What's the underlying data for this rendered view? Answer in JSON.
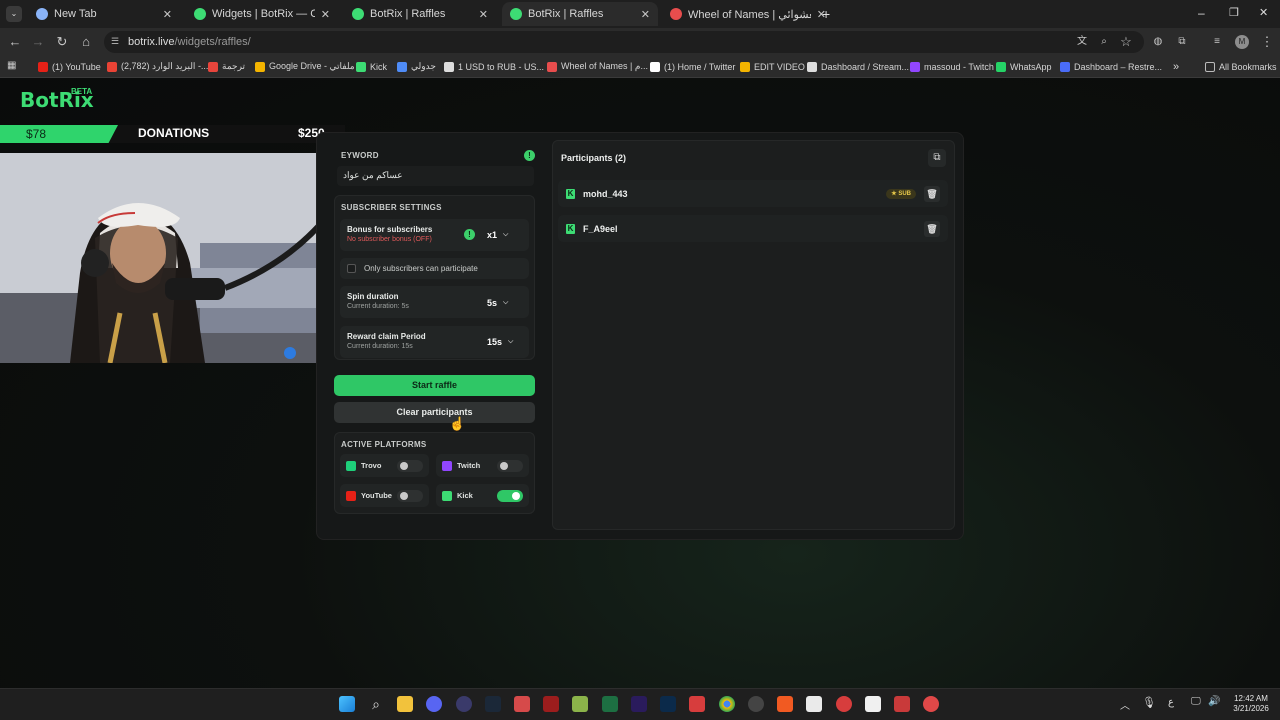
{
  "browser": {
    "tabs": [
      {
        "label": "New Tab",
        "color": "#8ab4f8"
      },
      {
        "label": "Widgets | BotRix — Cloud Strea",
        "color": "#3ddc74"
      },
      {
        "label": "BotRix | Raffles",
        "color": "#3ddc74"
      },
      {
        "label": "BotRix | Raffles",
        "color": "#3ddc74"
      },
      {
        "label": "Wheel of Names | سم العشوائي",
        "color": "#e84d4d"
      }
    ],
    "url_host": "botrix.live",
    "url_path": "/widgets/raffles/",
    "bookmarks": [
      {
        "label": "(1) YouTube",
        "color": "#e62117"
      },
      {
        "label": "(2,782) البريد الوارد -...",
        "color": "#ea4335"
      },
      {
        "label": "ترجمة",
        "color": "#e8453c"
      },
      {
        "label": "Google Drive - ملفاتي",
        "color": "#f4b400"
      },
      {
        "label": "Kick",
        "color": "#3ddc74"
      },
      {
        "label": "جدولي",
        "color": "#4f8cf7"
      },
      {
        "label": "1 USD to RUB - US...",
        "color": "#dddddd"
      },
      {
        "label": "Wheel of Names | م...",
        "color": "#e84d4d"
      },
      {
        "label": "(1) Home / Twitter",
        "color": "#ffffff"
      },
      {
        "label": "EDIT VIDEO",
        "color": "#f4b400"
      },
      {
        "label": "Dashboard / Stream...",
        "color": "#dddddd"
      },
      {
        "label": "massoud - Twitch",
        "color": "#9146ff"
      },
      {
        "label": "WhatsApp",
        "color": "#25d366"
      },
      {
        "label": "Dashboard – Restre...",
        "color": "#4a6cf7"
      }
    ],
    "all_bookmarks": "All Bookmarks"
  },
  "app": {
    "logo": "BotRix",
    "beta": "BETA"
  },
  "overlay": {
    "donation_current": "$78",
    "donation_label": "DONATIONS",
    "donation_goal": "$250"
  },
  "settings": {
    "keyword_label": "EYWORD",
    "keyword_value": "عساكم من عواد",
    "subscriber_title": "SUBSCRIBER SETTINGS",
    "bonus_title": "Bonus for subscribers",
    "bonus_sub": "No subscriber bonus (OFF)",
    "bonus_value": "x1",
    "only_subs": "Only subscribers can participate",
    "spin_title": "Spin duration",
    "spin_sub": "Current duration: 5s",
    "spin_value": "5s",
    "claim_title": "Reward claim Period",
    "claim_sub": "Current duration: 15s",
    "claim_value": "15s",
    "start_button": "Start raffle",
    "clear_button": "Clear participants",
    "platforms_title": "ACTIVE PLATFORMS",
    "platforms": [
      {
        "name": "Trovo",
        "enabled": false,
        "color": "#1ecf7a"
      },
      {
        "name": "Twitch",
        "enabled": false,
        "color": "#9146ff"
      },
      {
        "name": "YouTube",
        "enabled": false,
        "color": "#e62117"
      },
      {
        "name": "Kick",
        "enabled": true,
        "color": "#3ddc74"
      }
    ]
  },
  "participants": {
    "title": "Participants (2)",
    "items": [
      {
        "name": "mohd_443",
        "badge": "SUB"
      },
      {
        "name": "F_A9eel",
        "badge": ""
      }
    ]
  },
  "taskbar": {
    "time": "12:42 AM",
    "date": "3/21/2026",
    "lang": "ع"
  }
}
